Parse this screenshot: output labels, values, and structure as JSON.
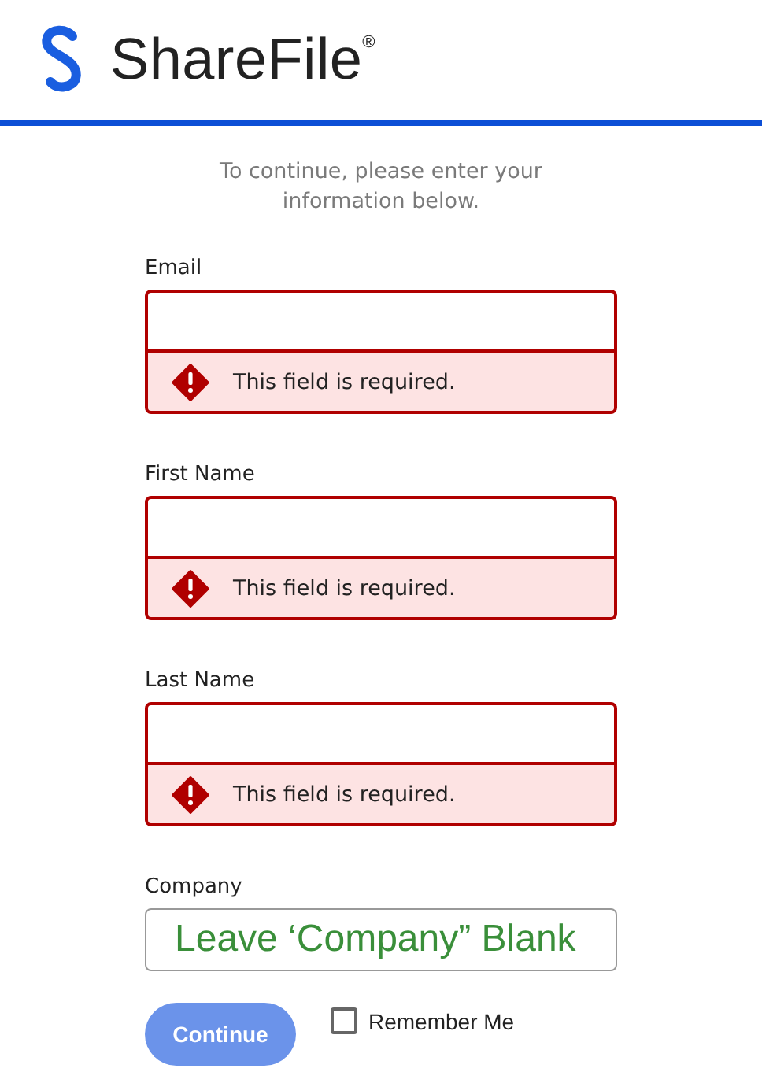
{
  "header": {
    "brand": "ShareFile",
    "mark": "®"
  },
  "intro": "To continue, please enter your information below.",
  "fields": [
    {
      "label": "Email",
      "invalid": true,
      "error": "This field is required."
    },
    {
      "label": "First Name",
      "invalid": true,
      "error": "This field is required."
    },
    {
      "label": "Last Name",
      "invalid": true,
      "error": "This field is required."
    },
    {
      "label": "Company",
      "invalid": false,
      "value": "Leave ‘Company” Blank"
    }
  ],
  "continue_button": {
    "label": "Continue",
    "disabled": true
  },
  "remember_me": {
    "label": "Remember Me",
    "checked": false
  }
}
